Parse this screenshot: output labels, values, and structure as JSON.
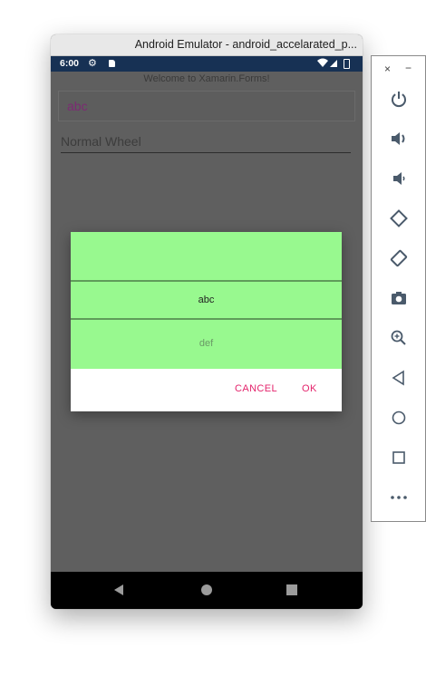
{
  "window": {
    "title": "Android Emulator - android_accelarated_p..."
  },
  "status_bar": {
    "time": "6:00",
    "icons": [
      "gear-icon",
      "sd-card-icon",
      "wifi-icon",
      "signal-icon",
      "battery-icon"
    ]
  },
  "app": {
    "welcome_text": "Welcome to Xamarin.Forms!",
    "entry_value": "abc",
    "wheel_label": "Normal Wheel"
  },
  "dialog": {
    "items": [
      "",
      "abc",
      "def"
    ],
    "selected": "abc",
    "cancel_label": "CANCEL",
    "ok_label": "OK"
  },
  "nav_bar": {
    "buttons": [
      "back-icon",
      "home-icon",
      "recents-icon"
    ]
  },
  "side_toolbar": {
    "close_label": "×",
    "minimize_label": "−",
    "buttons": [
      "power-icon",
      "volume-up-icon",
      "volume-down-icon",
      "rotate-left-icon",
      "rotate-right-icon",
      "camera-icon",
      "zoom-icon",
      "back-icon",
      "home-icon",
      "overview-icon",
      "more-icon"
    ]
  },
  "colors": {
    "status_bar": "#173154",
    "app_background": "#5f5f5f",
    "picker_background": "#98f98f",
    "picker_divider": "#5f9c5a",
    "accent": "#e4246c",
    "entry_text": "#7c2a73",
    "toolbar_icon": "#4a5a6b"
  }
}
